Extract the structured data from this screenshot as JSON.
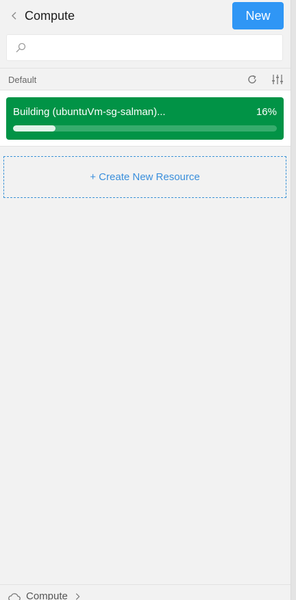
{
  "header": {
    "title": "Compute",
    "new_label": "New"
  },
  "search": {
    "value": "",
    "placeholder": ""
  },
  "group": {
    "label": "Default"
  },
  "resources": [
    {
      "name": "Building (ubuntuVm-sg-salman)...",
      "progress_label": "16%",
      "progress": 0.16,
      "color": "#019346"
    }
  ],
  "create": {
    "label": "+ Create New Resource"
  },
  "footer": {
    "crumb_label": "Compute"
  },
  "colors": {
    "accent": "#2f96f5",
    "success": "#019346",
    "link": "#3a8fdc"
  }
}
